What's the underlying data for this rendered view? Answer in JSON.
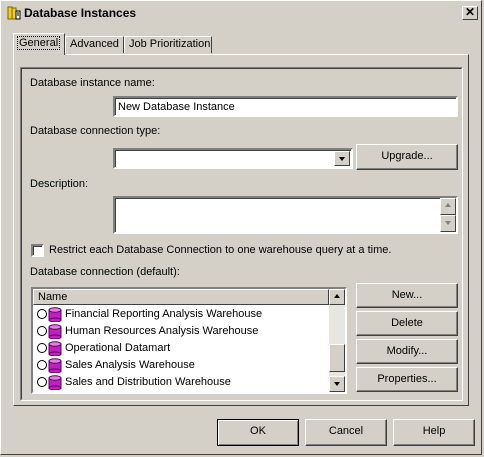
{
  "window": {
    "title": "Database Instances",
    "close_glyph": "✕"
  },
  "tabs": [
    {
      "label": "General",
      "active": true
    },
    {
      "label": "Advanced",
      "active": false
    },
    {
      "label": "Job Prioritization",
      "active": false
    }
  ],
  "form": {
    "instance_name_label": "Database instance name:",
    "instance_name_value": "New Database Instance",
    "connection_type_label": "Database connection type:",
    "connection_type_value": "",
    "upgrade_button": "Upgrade...",
    "description_label": "Description:",
    "description_value": "",
    "restrict_checkbox_label": "Restrict each Database Connection to one warehouse query at a time.",
    "restrict_checked": false,
    "default_connection_label": "Database connection (default):"
  },
  "connection_list": {
    "column_header": "Name",
    "items": [
      "Financial Reporting Analysis Warehouse",
      "Human Resources Analysis Warehouse",
      "Operational Datamart",
      "Sales Analysis Warehouse",
      "Sales and Distribution Warehouse"
    ]
  },
  "list_buttons": {
    "new": "New...",
    "delete": "Delete",
    "modify": "Modify...",
    "properties": "Properties..."
  },
  "footer": {
    "ok": "OK",
    "cancel": "Cancel",
    "help": "Help"
  },
  "colors": {
    "face": "#d4d0c8",
    "db_icon": "#c020c0",
    "db_icon_top": "#e080e0"
  },
  "icons": {
    "title": "database-instances-icon",
    "row": "database-cylinder-icon"
  }
}
